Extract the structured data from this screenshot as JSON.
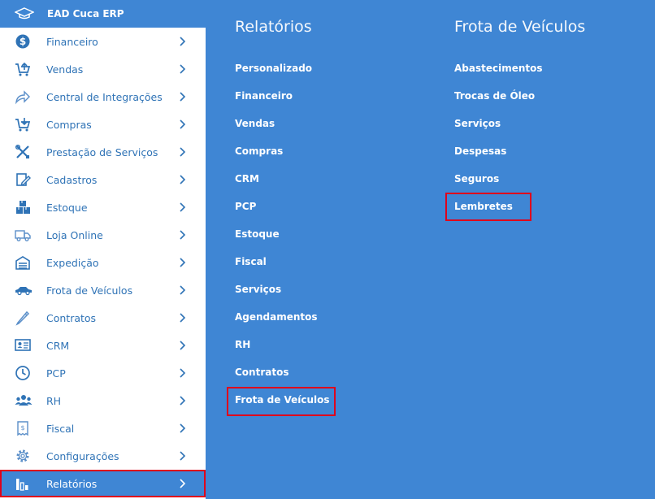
{
  "colors": {
    "accent": "#3f86d4",
    "sidebar_bg": "#ffffff",
    "sidebar_text": "#2f73b6",
    "highlight": "#e0001b"
  },
  "sidebar": {
    "brand": "EAD Cuca ERP",
    "brand_icon": "graduation-cap-icon",
    "items": [
      {
        "label": "Financeiro",
        "icon": "dollar-icon"
      },
      {
        "label": "Vendas",
        "icon": "cart-up-icon"
      },
      {
        "label": "Central de Integrações",
        "icon": "share-arrow-icon"
      },
      {
        "label": "Compras",
        "icon": "cart-down-icon"
      },
      {
        "label": "Prestação de Serviços",
        "icon": "tools-icon"
      },
      {
        "label": "Cadastros",
        "icon": "edit-icon"
      },
      {
        "label": "Estoque",
        "icon": "boxes-icon"
      },
      {
        "label": "Loja Online",
        "icon": "truck-icon"
      },
      {
        "label": "Expedição",
        "icon": "warehouse-icon"
      },
      {
        "label": "Frota de Veículos",
        "icon": "car-icon"
      },
      {
        "label": "Contratos",
        "icon": "pen-icon"
      },
      {
        "label": "CRM",
        "icon": "id-card-icon"
      },
      {
        "label": "PCP",
        "icon": "clock-icon"
      },
      {
        "label": "RH",
        "icon": "users-icon"
      },
      {
        "label": "Fiscal",
        "icon": "receipt-icon"
      },
      {
        "label": "Configurações",
        "icon": "gear-icon"
      },
      {
        "label": "Relatórios",
        "icon": "bar-chart-icon"
      }
    ]
  },
  "relatorios": {
    "title": "Relatórios",
    "items": [
      "Personalizado",
      "Financeiro",
      "Vendas",
      "Compras",
      "CRM",
      "PCP",
      "Estoque",
      "Fiscal",
      "Serviços",
      "Agendamentos",
      "RH",
      "Contratos",
      "Frota de Veículos"
    ]
  },
  "frota": {
    "title": "Frota de Veículos",
    "items": [
      "Abastecimentos",
      "Trocas de Óleo",
      "Serviços",
      "Despesas",
      "Seguros",
      "Lembretes"
    ]
  }
}
